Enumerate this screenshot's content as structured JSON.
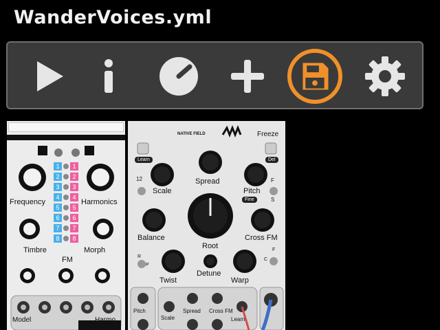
{
  "window": {
    "title": "WanderVoices.yml"
  },
  "toolbar": {
    "buttons": [
      {
        "name": "play",
        "icon": "play-icon"
      },
      {
        "name": "info",
        "icon": "info-icon"
      },
      {
        "name": "knob",
        "icon": "knob-icon"
      },
      {
        "name": "add",
        "icon": "plus-icon"
      },
      {
        "name": "save",
        "icon": "floppy-disk-icon",
        "highlight": "#f0902a"
      },
      {
        "name": "settings",
        "icon": "gear-icon"
      }
    ]
  },
  "modules": {
    "left": {
      "labels": {
        "frequency": "Frequency",
        "harmonics": "Harmonics",
        "timbre": "Timbre",
        "morph": "Morph",
        "fm": "FM",
        "model": "Model",
        "harmo": "Harmo"
      },
      "left_column": [
        "1",
        "2",
        "3",
        "4",
        "5",
        "6",
        "7",
        "8"
      ],
      "right_column": [
        "1",
        "2",
        "3",
        "4",
        "5",
        "6",
        "7",
        "8"
      ],
      "left_color": "#4ab0e8",
      "right_color": "#ee5f9f"
    },
    "right": {
      "labels": {
        "brand": "NATIVE FIELD",
        "freeze": "Freeze",
        "learn": "Learn",
        "del": "Del",
        "num": "12",
        "scale": "Scale",
        "spread": "Spread",
        "pitch": "Pitch",
        "fine": "Fine",
        "f_top": "F",
        "s_top": "S",
        "balance": "Balance",
        "root": "Root",
        "cross_fm": "Cross FM",
        "r": "R",
        "p": "P",
        "f_mid": "F",
        "c": "C",
        "twist": "Twist",
        "detune": "Detune",
        "warp": "Warp",
        "jack_pitch": "Pitch",
        "jack_scale": "Scale",
        "jack_spread": "Spread",
        "jack_crossfm": "Cross FM",
        "jack_learn": "Learn"
      }
    }
  }
}
